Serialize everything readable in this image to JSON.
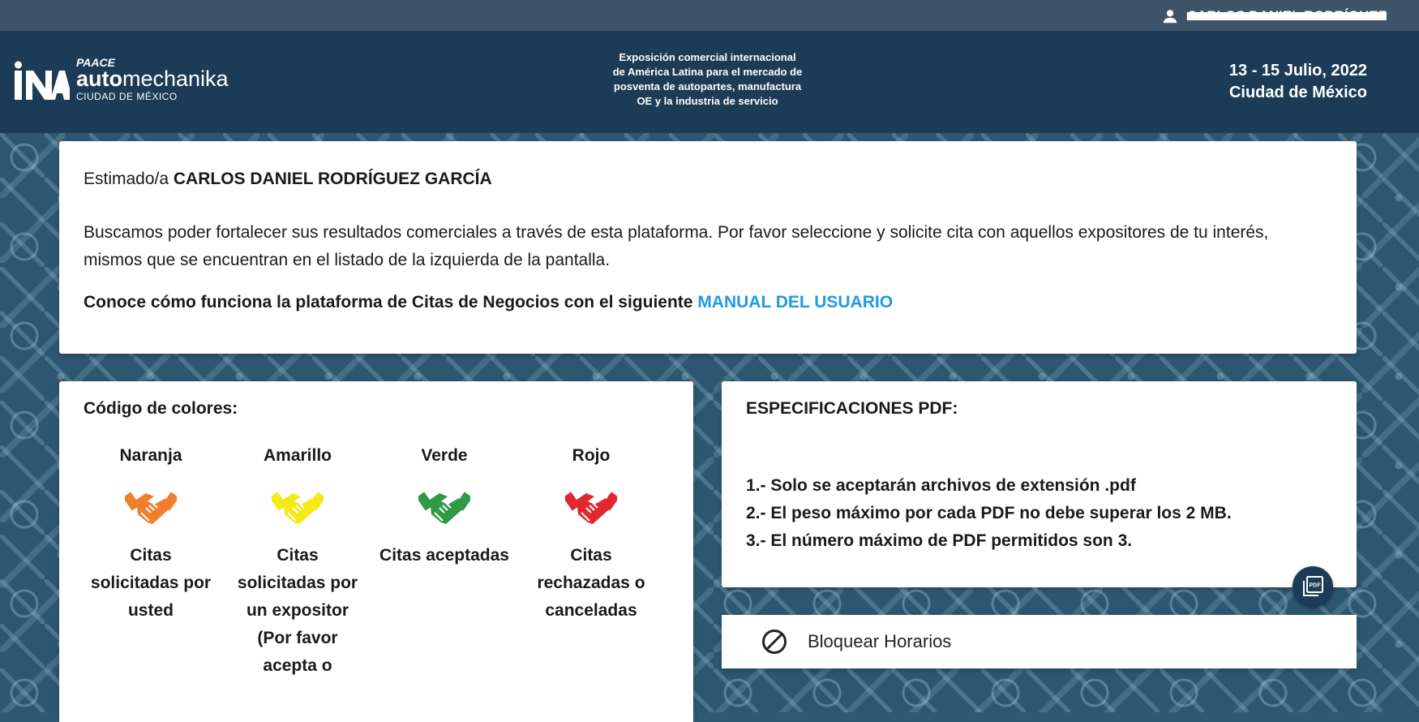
{
  "topbar": {
    "user_name": "CARLOS DANIEL RODRÍGUEZ",
    "user_icon": "person-icon"
  },
  "header": {
    "logo": {
      "paace": "PAACE",
      "auto": "auto",
      "mechanika": "mechanika",
      "city": "CIUDAD DE MÉXICO"
    },
    "tagline": [
      "Exposición comercial internacional",
      "de América Latina para el mercado de",
      "posventa de autopartes, manufactura",
      "OE y la industria de servicio"
    ],
    "event_dates": "13 - 15 Julio, 2022",
    "event_city": "Ciudad de México"
  },
  "welcome": {
    "greeting_prefix": "Estimado/a ",
    "name": "CARLOS DANIEL RODRÍGUEZ GARCÍA",
    "description": "Buscamos poder fortalecer sus resultados comerciales a través de esta plataforma. Por favor seleccione y solicite cita con aquellos expositores de tu interés, mismos que se encuentran en el listado de la izquierda de la pantalla.",
    "manual_text": "Conoce cómo funciona la plataforma de Citas de Negocios con el siguiente ",
    "manual_link": "MANUAL DEL USUARIO"
  },
  "color_code": {
    "title": "Código de colores:",
    "items": [
      {
        "name": "Naranja",
        "color": "#f07f2d",
        "icon": "handshake-icon",
        "description": "Citas solicitadas por usted"
      },
      {
        "name": "Amarillo",
        "color": "#f4ea16",
        "icon": "handshake-icon",
        "description": "Citas solicitadas por un expositor (Por favor acepta o"
      },
      {
        "name": "Verde",
        "color": "#2f9a44",
        "icon": "handshake-icon",
        "description": "Citas aceptadas"
      },
      {
        "name": "Rojo",
        "color": "#e0282e",
        "icon": "handshake-icon",
        "description": "Citas rechazadas o canceladas"
      }
    ]
  },
  "pdf_specs": {
    "title": "ESPECIFICACIONES PDF:",
    "items": [
      "1.- Solo se aceptarán archivos de extensión .pdf",
      "2.- El peso máximo por cada PDF no debe superar los 2 MB.",
      "3.- El número máximo de PDF permitidos son 3."
    ],
    "button_icon": "pdf-icon",
    "button_label": "PDF"
  },
  "block_schedule": {
    "icon": "block-icon",
    "label": "Bloquear Horarios"
  },
  "colors": {
    "header_bg": "#1b3b57",
    "topbar_bg": "#3f5468",
    "link": "#1e9ae6"
  }
}
